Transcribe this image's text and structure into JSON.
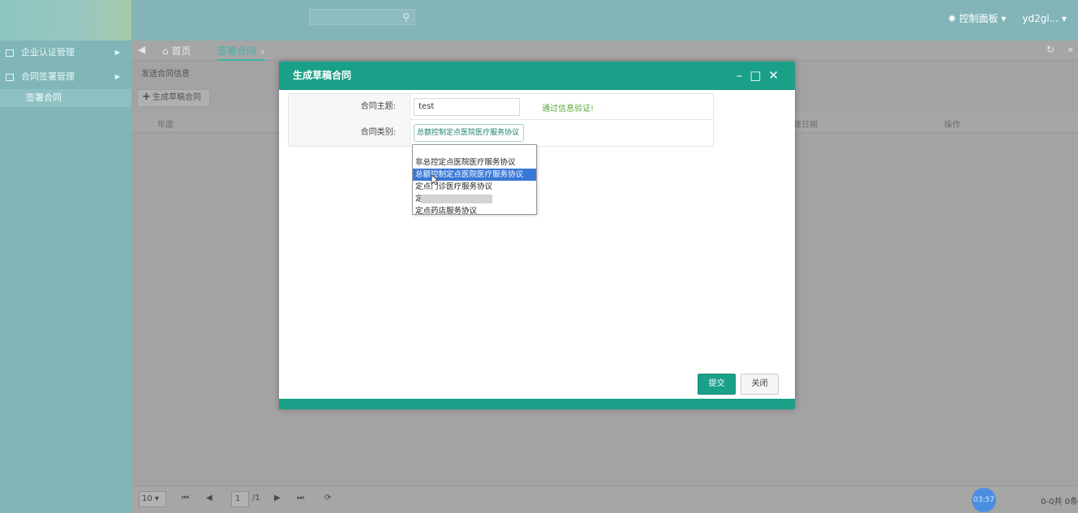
{
  "topbar": {
    "control_panel_label": "控制面板",
    "user_label": "yd2gl..."
  },
  "sidebar": {
    "items": [
      {
        "label": "企业认证管理"
      },
      {
        "label": "合同签署管理"
      }
    ],
    "sub_items": [
      {
        "label": "签署合同"
      }
    ]
  },
  "tabs": [
    {
      "label": "首页"
    },
    {
      "label": "签署合同"
    }
  ],
  "main": {
    "breadcrumb": "发送合同信息",
    "create_button": "生成草稿合同",
    "columns": [
      "年度",
      "建日期",
      "操作"
    ]
  },
  "pager": {
    "page_size": "10",
    "page_number": "1",
    "page_total": "/1",
    "time": "03:57",
    "range": "0-0共 0条"
  },
  "modal": {
    "title": "生成草稿合同",
    "subject_label": "合同主题:",
    "subject_value": "test",
    "validation_text": "通过信息验证!",
    "type_label": "合同类别:",
    "type_value": "总额控制定点医院医疗服务协议",
    "options": [
      "非总控定点医院医疗服务协议",
      "总额控制定点医院医疗服务协议",
      "定点门诊医疗服务协议",
      "定",
      "定点药店服务协议"
    ],
    "submit_label": "提交",
    "close_label": "关闭"
  },
  "colors": {
    "accent": "#1aa088",
    "selected_option": "#3a78d6",
    "validation": "#5aa83a"
  }
}
